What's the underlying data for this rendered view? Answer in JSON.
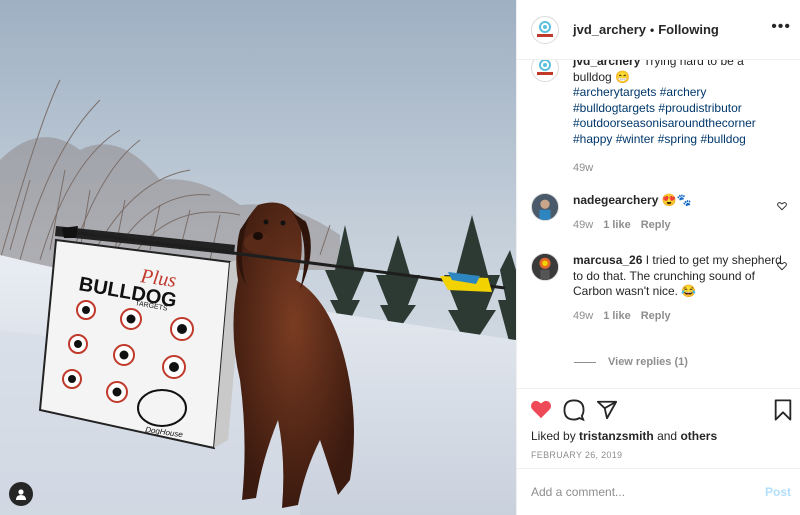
{
  "post": {
    "photo_alt": "Dog holding an arrow in front of a Bulldog archery target in the snow",
    "target_brand": "Plus",
    "target_name": "BULLDOG",
    "target_sub": "TARGETS",
    "target_badge": "DogHouse"
  },
  "header": {
    "username": "jvd_archery",
    "separator": "•",
    "follow_status": "Following",
    "more_label": "•••"
  },
  "caption": {
    "username": "jvd_archery",
    "text": "Trying hard to be a bulldog 😁",
    "hashtags": [
      "#archerytargets",
      "#archery",
      "#bulldogtargets",
      "#proudistributor",
      "#outdoorseasonisaroundthecorner",
      "#happy",
      "#winter",
      "#spring",
      "#bulldog"
    ],
    "time": "49w"
  },
  "comments": [
    {
      "username": "nadegearchery",
      "text": "😍🐾",
      "time": "49w",
      "likes": "1 like",
      "reply": "Reply"
    },
    {
      "username": "marcusa_26",
      "text": "I tried to get my shepherd to do that. The crunching sound of Carbon wasn't nice. 😂",
      "time": "49w",
      "likes": "1 like",
      "reply": "Reply"
    }
  ],
  "view_replies": "View replies (1)",
  "likes": {
    "prefix": "Liked by",
    "user": "tristanzsmith",
    "and": "and",
    "others": "others"
  },
  "date": "FEBRUARY 26, 2019",
  "add_comment": {
    "placeholder": "Add a comment...",
    "post_label": "Post"
  },
  "colors": {
    "like_red": "#ed4956",
    "hashtag": "#00376b",
    "muted": "#8e8e8e",
    "post_disabled": "#b2dffc"
  },
  "icons": [
    "heart-icon",
    "comment-icon",
    "share-icon",
    "bookmark-icon",
    "user-tag-icon"
  ]
}
